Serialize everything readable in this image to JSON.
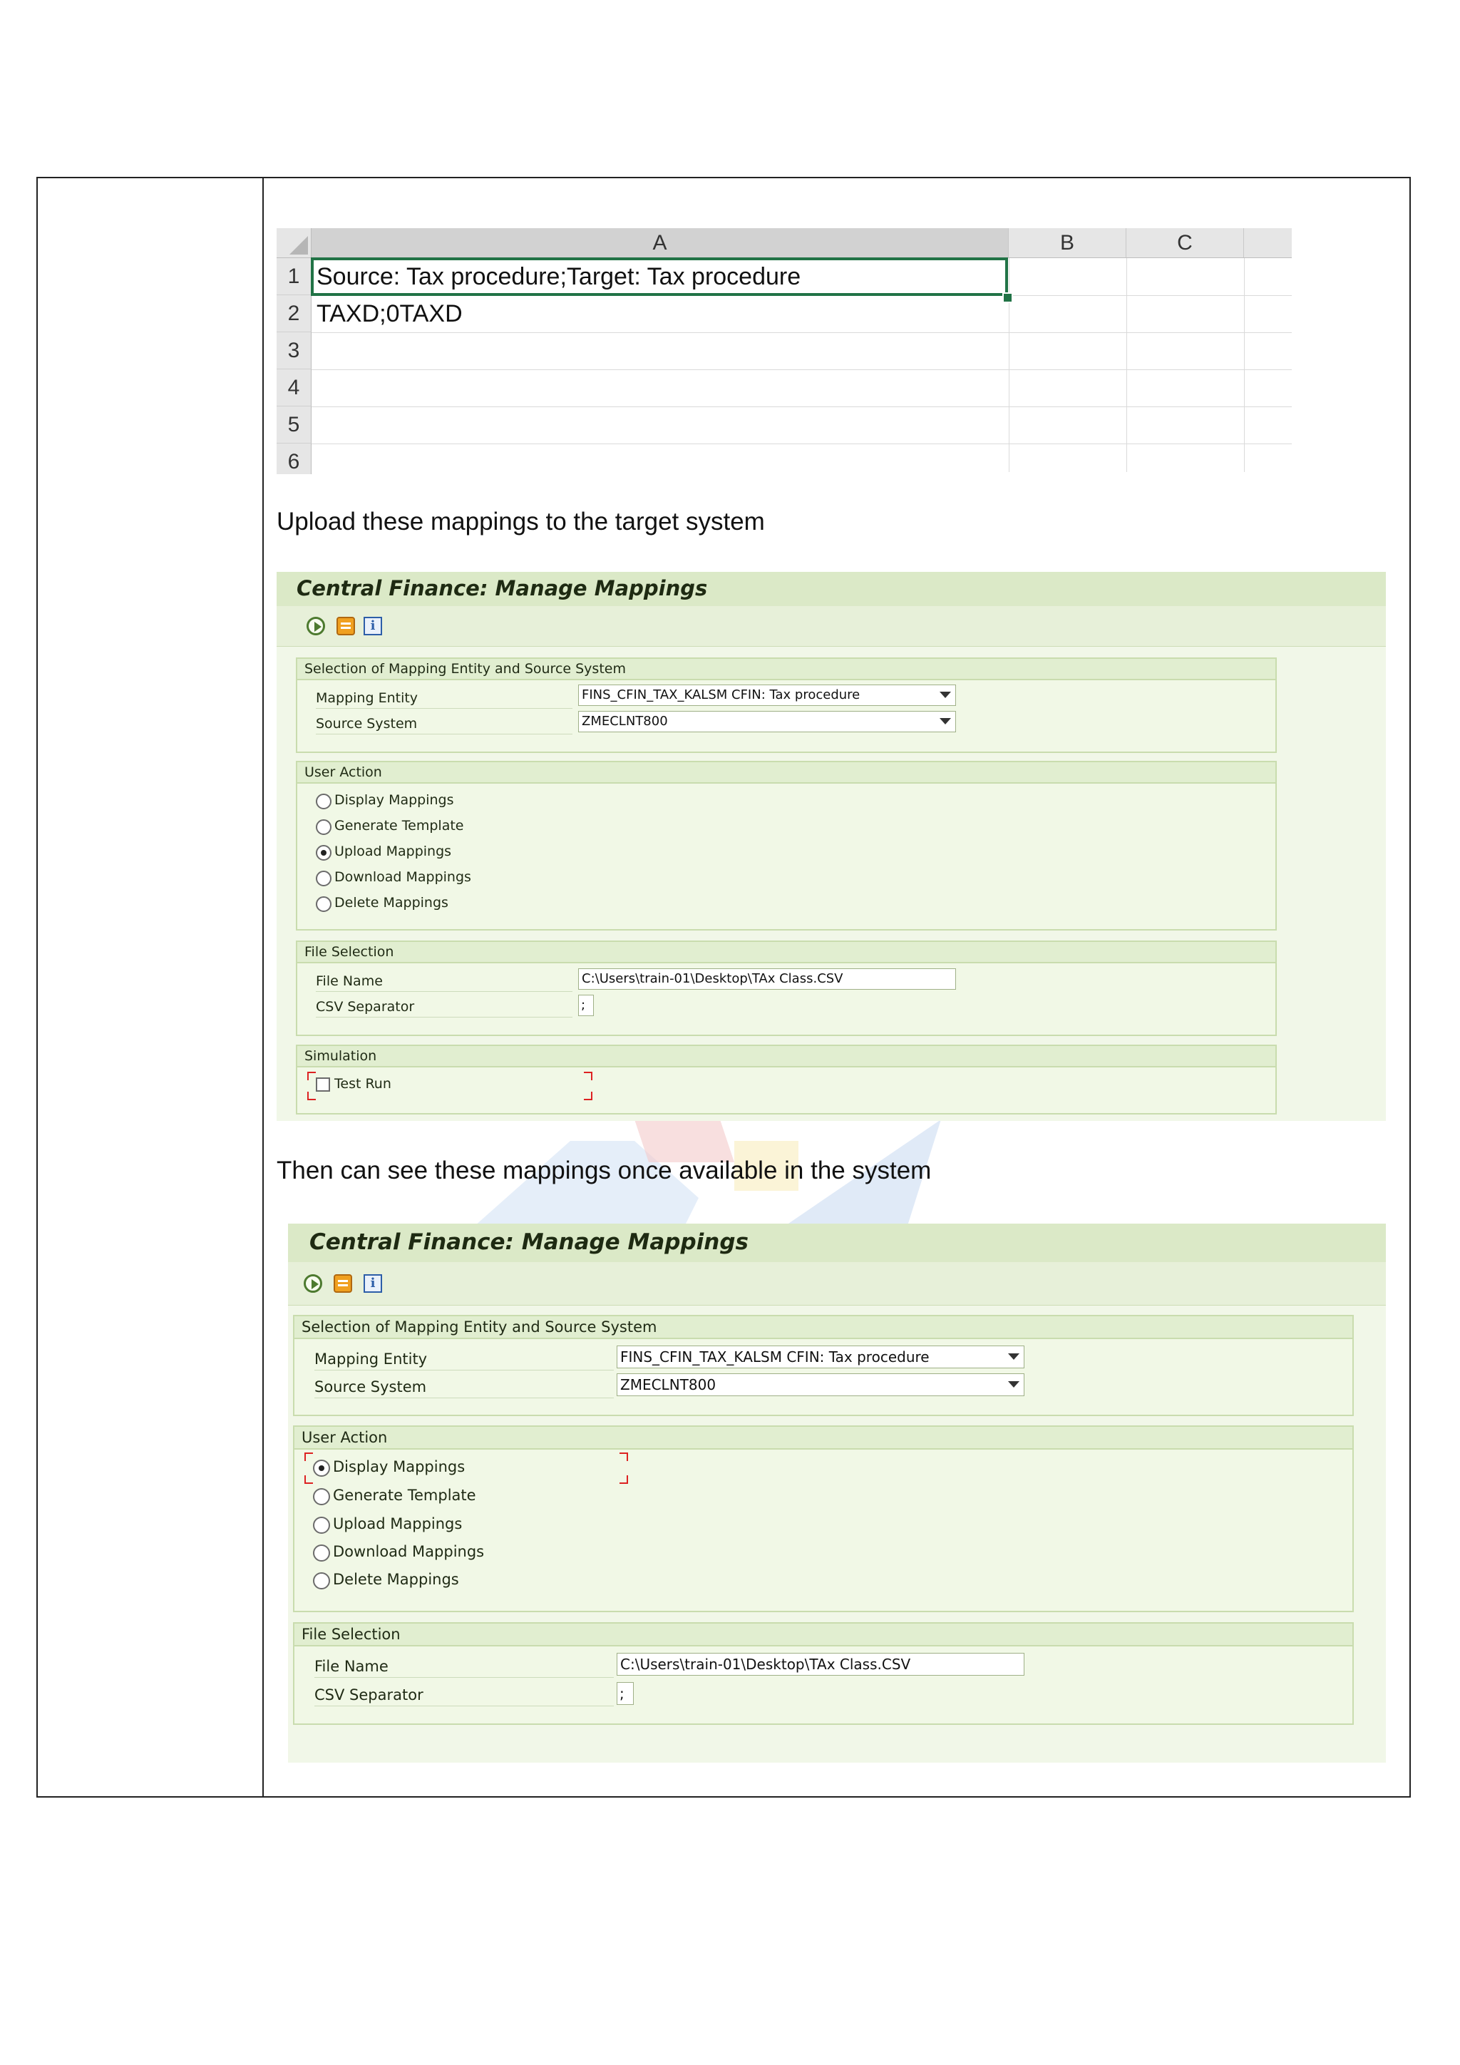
{
  "excel": {
    "columns": [
      "A",
      "B",
      "C"
    ],
    "row_numbers": [
      "1",
      "2",
      "3",
      "4",
      "5",
      "6"
    ],
    "cells": {
      "A1": "Source: Tax procedure;Target: Tax procedure",
      "A2": "TAXD;0TAXD"
    }
  },
  "paragraphs": {
    "upload": "Upload these mappings to the target system",
    "then": "Then can see these mappings once available in the system"
  },
  "screen1": {
    "title": "Central Finance: Manage Mappings",
    "selection_group": "Selection of Mapping Entity and Source System",
    "mapping_entity_label": "Mapping Entity",
    "mapping_entity_value": "FINS_CFIN_TAX_KALSM CFIN: Tax procedure",
    "source_system_label": "Source System",
    "source_system_value": "ZMECLNT800",
    "user_action_group": "User Action",
    "actions": [
      "Display Mappings",
      "Generate Template",
      "Upload Mappings",
      "Download Mappings",
      "Delete Mappings"
    ],
    "selected_action": "Upload Mappings",
    "file_selection_group": "File Selection",
    "file_name_label": "File Name",
    "file_name_value": "C:\\Users\\train-01\\Desktop\\TAx Class.CSV",
    "csv_separator_label": "CSV Separator",
    "csv_separator_value": ";",
    "simulation_group": "Simulation",
    "test_run_label": "Test Run"
  },
  "screen2": {
    "title": "Central Finance: Manage Mappings",
    "selection_group": "Selection of Mapping Entity and Source System",
    "mapping_entity_label": "Mapping Entity",
    "mapping_entity_value": "FINS_CFIN_TAX_KALSM CFIN: Tax procedure",
    "source_system_label": "Source System",
    "source_system_value": "ZMECLNT800",
    "user_action_group": "User Action",
    "actions": [
      "Display Mappings",
      "Generate Template",
      "Upload Mappings",
      "Download Mappings",
      "Delete Mappings"
    ],
    "selected_action": "Display Mappings",
    "file_selection_group": "File Selection",
    "file_name_label": "File Name",
    "file_name_value": "C:\\Users\\train-01\\Desktop\\TAx Class.CSV",
    "csv_separator_label": "CSV Separator",
    "csv_separator_value": ";"
  },
  "toolbar_icons": [
    "execute-icon",
    "get-variant-icon",
    "info-icon"
  ],
  "colors": {
    "sap_title_bg": "#dbe9c7",
    "sap_body_bg": "#f1f7e8",
    "excel_active_cell": "#217346"
  }
}
